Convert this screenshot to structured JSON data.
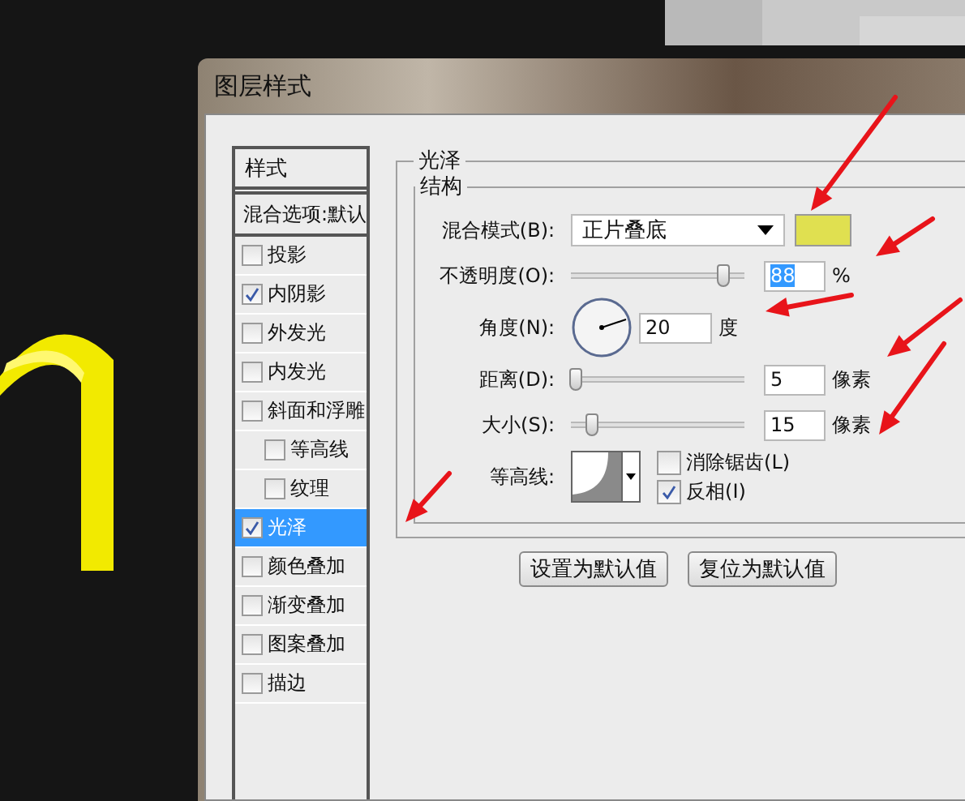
{
  "window": {
    "title": "图层样式"
  },
  "styles_panel": {
    "header": "样式",
    "blending_options": "混合选项:默认",
    "items": [
      {
        "label": "投影",
        "checked": false,
        "selected": false
      },
      {
        "label": "内阴影",
        "checked": true,
        "selected": false
      },
      {
        "label": "外发光",
        "checked": false,
        "selected": false
      },
      {
        "label": "内发光",
        "checked": false,
        "selected": false
      },
      {
        "label": "斜面和浮雕",
        "checked": false,
        "selected": false,
        "children": [
          {
            "label": "等高线",
            "checked": false,
            "selected": false
          },
          {
            "label": "纹理",
            "checked": false,
            "selected": false
          }
        ]
      },
      {
        "label": "光泽",
        "checked": true,
        "selected": true
      },
      {
        "label": "颜色叠加",
        "checked": false,
        "selected": false
      },
      {
        "label": "渐变叠加",
        "checked": false,
        "selected": false
      },
      {
        "label": "图案叠加",
        "checked": false,
        "selected": false
      },
      {
        "label": "描边",
        "checked": false,
        "selected": false
      }
    ]
  },
  "satin": {
    "title": "光泽",
    "structure": {
      "title": "结构",
      "blend_mode": {
        "label": "混合模式(B):",
        "value": "正片叠底",
        "color": "#e0e050"
      },
      "opacity": {
        "label": "不透明度(O):",
        "level": 0.88,
        "value": "88",
        "highlighted": true,
        "unit": "%"
      },
      "angle": {
        "label": "角度(N):",
        "value": "20",
        "unit": "度"
      },
      "distance": {
        "label": "距离(D):",
        "level": 0.03,
        "value": "5",
        "highlighted": false,
        "unit": "像素"
      },
      "size": {
        "label": "大小(S):",
        "level": 0.12,
        "value": "15",
        "highlighted": false,
        "unit": "像素"
      },
      "contour": {
        "label": "等高线:",
        "anti_aliased": {
          "label": "消除锯齿(L)",
          "checked": false
        },
        "invert": {
          "label": "反相(I)",
          "checked": true
        }
      }
    }
  },
  "buttons": [
    "设置为默认值",
    "复位为默认值"
  ]
}
